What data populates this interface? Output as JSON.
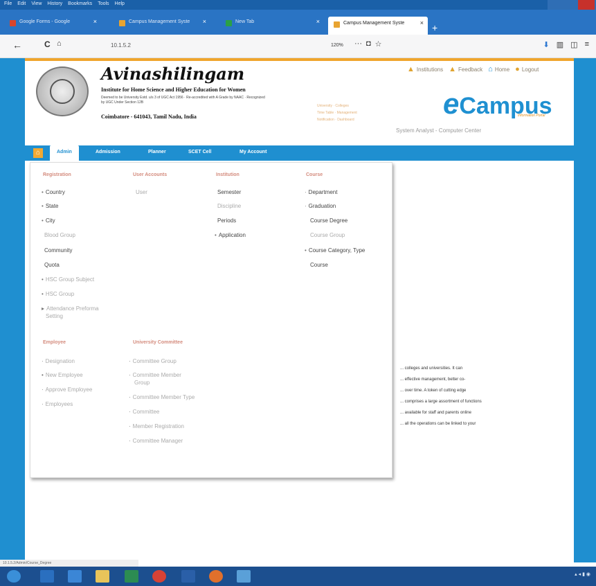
{
  "browser": {
    "menu": [
      "File",
      "Edit",
      "View",
      "History",
      "Bookmarks",
      "Tools",
      "Help"
    ],
    "tabs": [
      {
        "label": "Google Forms - Google"
      },
      {
        "label": "Campus Management Syste"
      },
      {
        "label": "New Tab"
      },
      {
        "label": "Campus Management Syste",
        "active": true
      }
    ],
    "url": "10.1.5.2",
    "zoom": "120%"
  },
  "header": {
    "title": "Avinashilingam",
    "subtitle": "Institute for Home Science and Higher Education for Women",
    "small_text": "Deemed to be University Estd. u/s 3 of UGC Act 1956 · Re-accredited with A Grade by NAAC · Recognized by UGC Under Section 12B",
    "address": "Coimbatore - 641043, Tamil Nadu, India",
    "top_links": [
      "Institutions",
      "Feedback",
      "Home",
      "Logout"
    ],
    "brand_e": "e",
    "brand": "Campus",
    "brand_tag": "Information Portal",
    "info_links": [
      "University",
      "Colleges",
      "Time Table",
      "Management",
      "Notification",
      "Dashboard"
    ],
    "role_text": "System Analyst - Computer Center"
  },
  "nav": {
    "items": [
      "Admin",
      "Admission",
      "Planner",
      "SCET Cell",
      "My Account"
    ]
  },
  "mega": {
    "col1_head": "Registration",
    "col1": [
      "Country",
      "State",
      "City",
      "Blood Group",
      "Community",
      "Quota",
      "HSC Group Subject",
      "HSC Group",
      "Attendance Preforma",
      "Setting"
    ],
    "col2_head": "User Accounts",
    "col2": [
      "User"
    ],
    "col3_head": "Institution",
    "col3": [
      "Semester",
      "Discipline",
      "Periods",
      "Application"
    ],
    "col4_head": "Course",
    "col4": [
      "Department",
      "Graduation",
      "Course Degree",
      "Course Group",
      "Course Category, Type",
      "Course"
    ],
    "col5_head": "Employee",
    "col5": [
      "Designation",
      "New Employee",
      "Approve Employee",
      "Employees"
    ],
    "col6_head": "University Committee",
    "col6": [
      "Committee Group",
      "Committee Member",
      "Group",
      "Committee Member Type",
      "Committee",
      "Member Registration",
      "Committee Manager"
    ]
  },
  "welcome": [
    "... colleges and universities. It can",
    "... effective management, better co-",
    "... over time. A token of cutting edge",
    "... comprises a large assortment of functions",
    "... available for staff and parents online",
    "... all the operations can be linked to your"
  ],
  "status": "10.1.5.2/Admin/Course_Degree"
}
